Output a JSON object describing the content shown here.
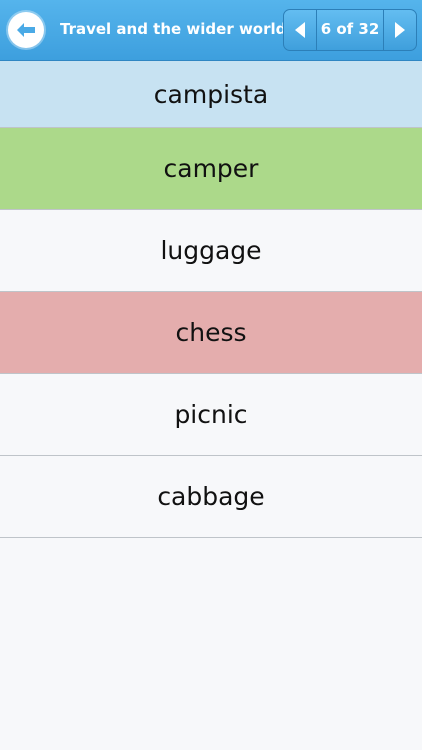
{
  "header": {
    "title": "Travel and the wider world",
    "pager_text": "6 of 32",
    "back_icon": "back-arrow-icon",
    "prev_icon": "chevron-left-icon",
    "next_icon": "chevron-right-icon"
  },
  "options": [
    {
      "label": "campista",
      "color": "#c7e2f2"
    },
    {
      "label": "camper",
      "color": "#acd98a"
    },
    {
      "label": "luggage",
      "color": "#f7f8fa"
    },
    {
      "label": "chess",
      "color": "#e4adad"
    },
    {
      "label": "picnic",
      "color": "#f7f8fa"
    },
    {
      "label": "cabbage",
      "color": "#f7f8fa"
    }
  ],
  "colors": {
    "navbar": "#4aaae6",
    "correct": "#acd98a",
    "wrong": "#e4adad",
    "prompt": "#c7e2f2"
  }
}
